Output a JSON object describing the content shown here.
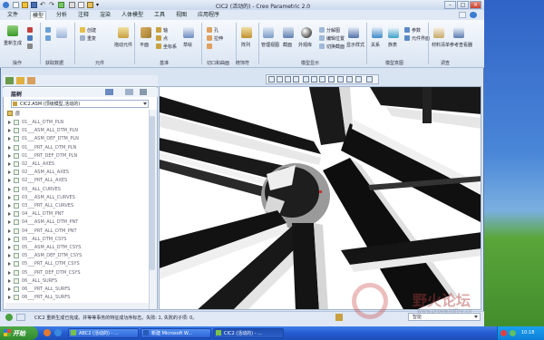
{
  "window": {
    "title": "CIC2 (活动的) - Creo Parametric 2.0",
    "buttons": {
      "minimize": "–",
      "maximize": "□",
      "close": "×"
    }
  },
  "menu": {
    "items": [
      "文件",
      "模型",
      "分析",
      "注释",
      "渲染",
      "人体模型",
      "工具",
      "视图",
      "应用程序"
    ],
    "active_index": 1
  },
  "ribbon": {
    "groups": [
      {
        "label": "操作"
      },
      {
        "label": "获取数据"
      },
      {
        "label": "元件"
      },
      {
        "label": "基准"
      },
      {
        "label": "切口和曲面"
      },
      {
        "label": "修饰符"
      },
      {
        "label": "模型显示"
      },
      {
        "label": "模型意图"
      },
      {
        "label": "调查"
      }
    ],
    "items": {
      "regenerate": "重新生成",
      "create": "创建",
      "repeat": "重复",
      "drag": "拖动元件",
      "plane": "平面",
      "axis": "轴",
      "point": "点",
      "coord": "坐标系",
      "sketch": "草绘",
      "hole": "孔",
      "extrude": "拉伸",
      "array": "阵列",
      "manage_view": "管理视图",
      "section": "截面",
      "appearance_lib": "外观库",
      "explode": "分解图",
      "edit_position": "编辑位置",
      "switch_section": "切换截面",
      "show_style": "显示样式",
      "relation": "关系",
      "family_table": "族表",
      "param": "参数",
      "eng_info": "元件界面",
      "bill": "材料清单",
      "ref_viewer": "参考查看器"
    }
  },
  "panel": {
    "title": "层树",
    "model_selector": "CIC2.ASM (顶级模型,活动的)",
    "root": "层",
    "rows": [
      "01__ALL_DTM_PLN",
      "01___ASM_ALL_DTM_PLN",
      "01___ASM_DEF_DTM_PLN",
      "01___PRT_ALL_DTM_PLN",
      "01___PRT_DEF_DTM_PLN",
      "02__ALL_AXES",
      "02___ASM_ALL_AXES",
      "02___PRT_ALL_AXES",
      "03__ALL_CURVES",
      "03___ASM_ALL_CURVES",
      "03___PRT_ALL_CURVES",
      "04__ALL_DTM_PNT",
      "04___ASM_ALL_DTM_PNT",
      "04___PRT_ALL_DTM_PNT",
      "05__ALL_DTM_CSYS",
      "05___ASM_ALL_DTM_CSYS",
      "05___ASM_DEF_DTM_CSYS",
      "05___PRT_ALL_DTM_CSYS",
      "05___PRT_DEF_DTM_CSYS",
      "06__ALL_SURFS",
      "06___PRT_ALL_SURFS",
      "06___PRT_ALL_SURFS"
    ]
  },
  "ribbon_dropdown": "模型显示 ▾",
  "status": {
    "message": "CIC2 重新生成已完成。并等等事务的特征成功序标志。失败: 1, 失败的子项: 0。",
    "smart": "智能"
  },
  "taskbar": {
    "start": "开始",
    "tasks": [
      "ABC2 (活动的) - ...",
      "新建 Microsoft W...",
      "CIC2 (活动的) - ..."
    ],
    "active_task_index": 2,
    "clock": "10:18"
  },
  "watermark": {
    "text": "野火论坛",
    "url": "www.proewildfire.cn"
  },
  "colors": {
    "ribbon_bg": "#e4ecf6",
    "viewport_bg": "#ffffff",
    "taskbar_blue": "#245bd1",
    "start_green": "#3a9a36"
  }
}
